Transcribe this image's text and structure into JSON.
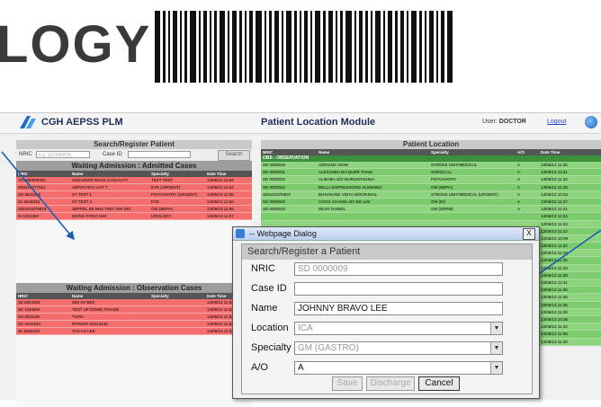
{
  "slide": {
    "title_fragment": "LOGY"
  },
  "app": {
    "title": "CGH AEPSS PLM",
    "module_title": "Patient Location Module",
    "user_label": "User:",
    "user_name": "DOCTOR",
    "logout": "Logout"
  },
  "left_panel": {
    "search_header": "Search/Register Patient",
    "nric_label": "NRIC",
    "nric_placeholder": "e.g.  S1234567A",
    "case_id_label": "Case ID",
    "search_button": "Search",
    "admitted_header": "Waiting Admission : Admitted Cases",
    "observation_header": "Waiting Admission : Observation Cases",
    "columns": [
      "NRIC",
      "Name",
      "Specialty",
      "Date Time"
    ],
    "admitted_rows": [
      [
        "YF0400000302",
        "UNKNOWN MASS CASUALTY",
        "TEST TEST",
        "14/06/13 11:54"
      ],
      [
        "S00421077014",
        "AEPSS RCV UAT 7",
        "EYE (URGENT)",
        "14/06/13 11:54"
      ],
      [
        "SD 6641216",
        "ST TEST 1",
        "PSYCHIATRY (URGENT)",
        "14/06/13 11:55"
      ],
      [
        "SJ 6643315",
        "ST TEST 2",
        "EYE",
        "14/06/13 11:56"
      ],
      [
        "XD0421076813",
        "SEPPEL KE BHA TING VWI DEI",
        "GM (NEPH)",
        "14/06/13 11:56"
      ],
      [
        "SI 1041382",
        "WONG FONG KIM",
        "UROLOGY",
        "14/06/13 11:57"
      ]
    ],
    "observation_rows": [
      [
        "SZ 0604005",
        "SIM AH BEE",
        "",
        "14/06/13 11:52"
      ],
      [
        "SZ 1234560",
        "TEST UP DOWN TRIAGE",
        "",
        "14/06/13 11:52"
      ],
      [
        "SH 0511005",
        "TIARA",
        "",
        "14/06/13 11:52"
      ],
      [
        "SC 0241344",
        "PATIENT 0241344C",
        "",
        "14/06/13 11:53"
      ],
      [
        "SL 0604220",
        "TAN AH LEE",
        "",
        "14/06/13 11:53"
      ]
    ]
  },
  "right_panel": {
    "header": "Patient Location",
    "columns": [
      "NRIC",
      "Name",
      "Specialty",
      "A/O",
      "Date Time"
    ],
    "section": "OBS - OBSERVATION",
    "rows": [
      [
        "SD 0000045",
        "ADRIANA VIOW",
        "STROKE UNIT/MEDICAL",
        "A",
        "13/06/13 11:36"
      ],
      [
        "SD 0000031",
        "ALEXANDA DICQUER THAM",
        "SURGICAL",
        "A",
        "13/06/13 11:31"
      ],
      [
        "SD 0000032",
        "ALIBABA S/O MURUKRISHNA",
        "PSYCHIATRY",
        "A",
        "13/06/13 11:32"
      ],
      [
        "SD 0000022",
        "BELLA EXPRESSIONS SLIMMING",
        "GM (NEPH)",
        "A",
        "13/06/13 11:28"
      ],
      [
        "XD0421076837",
        "BHAVNANE VIDYA MOORJMAL",
        "STROKE UNIT/MEDICAL (URGENT)",
        "A",
        "13/06/13 10:33"
      ],
      [
        "SD 0000020",
        "COCO CHANEL BO BO LIM",
        "GM (ID)",
        "A",
        "13/06/13 11:27"
      ],
      [
        "SD 0000010",
        "DEAR DANIEL",
        "GM (DERM)",
        "A",
        "13/06/13 11:21"
      ],
      [
        "",
        "",
        "",
        "",
        "13/06/13 11:24"
      ],
      [
        "",
        "",
        "",
        "",
        "13/06/13 11:23"
      ],
      [
        "",
        "",
        "",
        "",
        "13/06/13 11:22"
      ],
      [
        "",
        "",
        "",
        "",
        "14/06/13 10:09"
      ],
      [
        "",
        "",
        "",
        "",
        "13/06/13 11:34"
      ],
      [
        "",
        "",
        "",
        "",
        "13/06/13 11:19"
      ],
      [
        "",
        "",
        "",
        "",
        "13/06/13 11:35"
      ],
      [
        "",
        "",
        "",
        "",
        "13/06/13 11:23"
      ],
      [
        "",
        "",
        "",
        "",
        "13/06/13 11:39"
      ],
      [
        "",
        "",
        "",
        "",
        "13/06/13 11:41"
      ],
      [
        "",
        "",
        "",
        "",
        "13/06/13 11:36"
      ],
      [
        "",
        "",
        "",
        "",
        "13/06/13 11:26"
      ],
      [
        "",
        "",
        "",
        "",
        "13/06/13 11:26"
      ],
      [
        "",
        "",
        "",
        "",
        "13/06/13 11:29"
      ],
      [
        "",
        "",
        "",
        "",
        "13/06/13 10:36"
      ],
      [
        "",
        "",
        "",
        "",
        "13/06/13 11:33"
      ],
      [
        "",
        "",
        "",
        "",
        "13/06/13 11:08"
      ],
      [
        "",
        "",
        "",
        "",
        "14/06/13 11:38"
      ]
    ]
  },
  "dialog": {
    "title": "-- Webpage Dialog",
    "close": "X",
    "header": "Search/Register a Patient",
    "nric_label": "NRIC",
    "nric_value": "SD  0000009",
    "case_id_label": "Case ID",
    "case_id_value": "",
    "name_label": "Name",
    "name_value": "JOHNNY BRAVO LEE",
    "location_label": "Location",
    "location_value": "ICA",
    "specialty_label": "Specialty",
    "specialty_value": "GM (GASTRO)",
    "ao_label": "A/O",
    "ao_value": "A",
    "save_button": "Save",
    "discharge_button": "Discharge",
    "cancel_button": "Cancel"
  },
  "colors": {
    "admitted_row": "#f46e6e",
    "location_row": "#8fd47f",
    "location_row_alt": "#7ccb6c",
    "header_gray": "#9e9e9e",
    "annotation_arrow": "#1a5fb0"
  }
}
